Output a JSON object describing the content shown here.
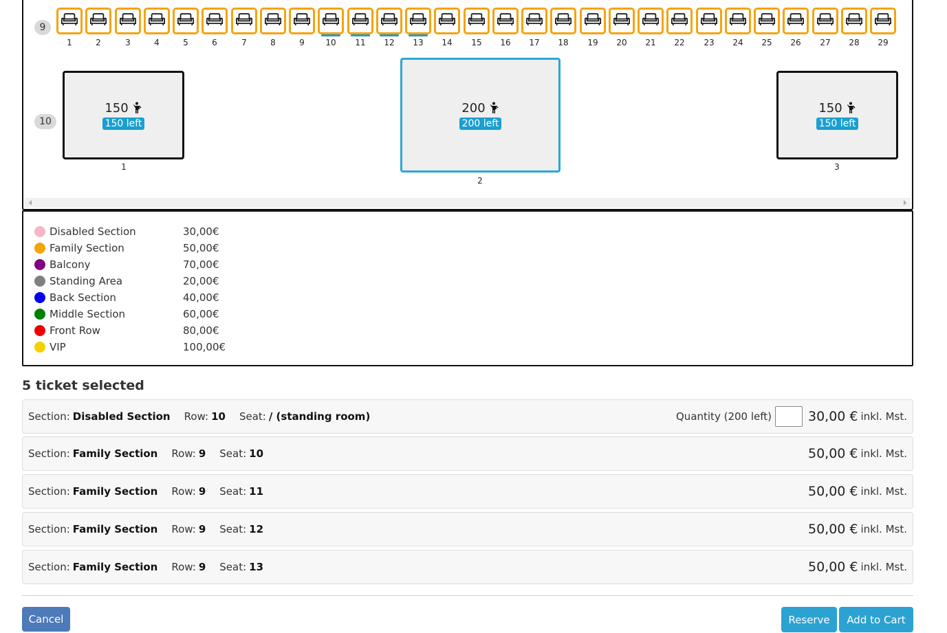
{
  "seat_map": {
    "row9": {
      "label": "9",
      "seats": [
        "1",
        "2",
        "3",
        "4",
        "5",
        "6",
        "7",
        "8",
        "9",
        "10",
        "11",
        "12",
        "13",
        "14",
        "15",
        "16",
        "17",
        "18",
        "19",
        "20",
        "21",
        "22",
        "23",
        "24",
        "25",
        "26",
        "27",
        "28",
        "29"
      ],
      "selected": [
        "10",
        "11",
        "12",
        "13"
      ]
    },
    "row10": {
      "label": "10",
      "areas": [
        {
          "number": "1",
          "capacity": "150",
          "left": "150 left"
        },
        {
          "number": "2",
          "capacity": "200",
          "left": "200 left"
        },
        {
          "number": "3",
          "capacity": "150",
          "left": "150 left"
        }
      ]
    }
  },
  "legend": [
    {
      "name": "Disabled Section",
      "price": "30,00€",
      "color": "#f7b6c8"
    },
    {
      "name": "Family Section",
      "price": "50,00€",
      "color": "#f5a30c"
    },
    {
      "name": "Balcony",
      "price": "70,00€",
      "color": "#800080"
    },
    {
      "name": "Standing Area",
      "price": "20,00€",
      "color": "#808080"
    },
    {
      "name": "Back Section",
      "price": "40,00€",
      "color": "#0000ee"
    },
    {
      "name": "Middle Section",
      "price": "60,00€",
      "color": "#008000"
    },
    {
      "name": "Front Row",
      "price": "80,00€",
      "color": "#ee0000"
    },
    {
      "name": "VIP",
      "price": "100,00€",
      "color": "#f7d000"
    }
  ],
  "selection": {
    "title": "5 ticket selected",
    "labels": {
      "section": "Section:",
      "row": "Row:",
      "seat": "Seat:",
      "quantity": "Quantity (200 left)",
      "tax": "inkl. Mst."
    },
    "tickets": [
      {
        "section": "Disabled Section",
        "row": "10",
        "seat": "/ (standing room)",
        "price": "30,00 €",
        "has_quantity": true
      },
      {
        "section": "Family Section",
        "row": "9",
        "seat": "10",
        "price": "50,00 €"
      },
      {
        "section": "Family Section",
        "row": "9",
        "seat": "11",
        "price": "50,00 €"
      },
      {
        "section": "Family Section",
        "row": "9",
        "seat": "12",
        "price": "50,00 €"
      },
      {
        "section": "Family Section",
        "row": "9",
        "seat": "13",
        "price": "50,00 €"
      }
    ]
  },
  "actions": {
    "cancel": "Cancel",
    "reserve": "Reserve",
    "cart": "Add to Cart"
  }
}
